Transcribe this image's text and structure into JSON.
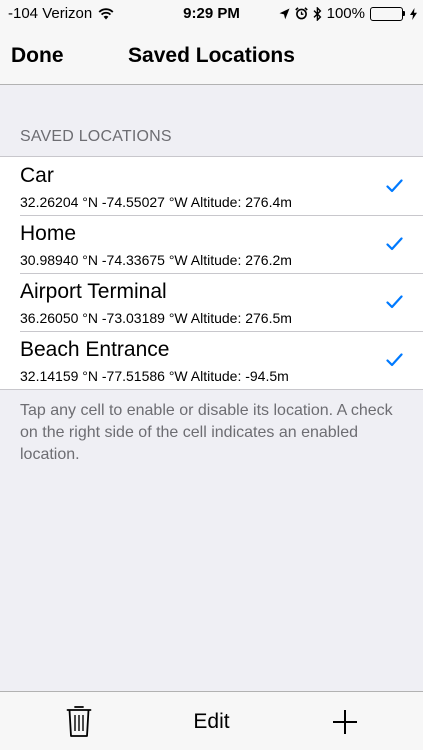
{
  "status_bar": {
    "carrier": "-104 Verizon",
    "time": "9:29 PM",
    "battery": "100%",
    "icons": [
      "wifi-icon",
      "location-arrow-icon",
      "alarm-icon",
      "bluetooth-icon",
      "battery-icon",
      "charging-bolt-icon"
    ]
  },
  "nav": {
    "done_label": "Done",
    "title": "Saved Locations"
  },
  "section": {
    "header": "SAVED LOCATIONS",
    "items": [
      {
        "name": "Car",
        "coords": "32.26204 °N -74.55027 °W Altitude: 276.4m",
        "enabled": true
      },
      {
        "name": "Home",
        "coords": "30.98940 °N -74.33675 °W Altitude: 276.2m",
        "enabled": true
      },
      {
        "name": "Airport Terminal",
        "coords": "36.26050 °N -73.03189 °W Altitude: 276.5m",
        "enabled": true
      },
      {
        "name": "Beach Entrance",
        "coords": "32.14159 °N -77.51586 °W Altitude: -94.5m",
        "enabled": true
      }
    ],
    "footer": "Tap any cell to enable or disable its location. A check on the right side of the cell indicates an enabled location."
  },
  "toolbar": {
    "edit_label": "Edit",
    "icons": [
      "trash-icon",
      "plus-icon"
    ]
  },
  "colors": {
    "accent": "#007aff",
    "background": "#efeff4",
    "battery_fill": "#4cd964",
    "secondary_text": "#6d6d72"
  }
}
